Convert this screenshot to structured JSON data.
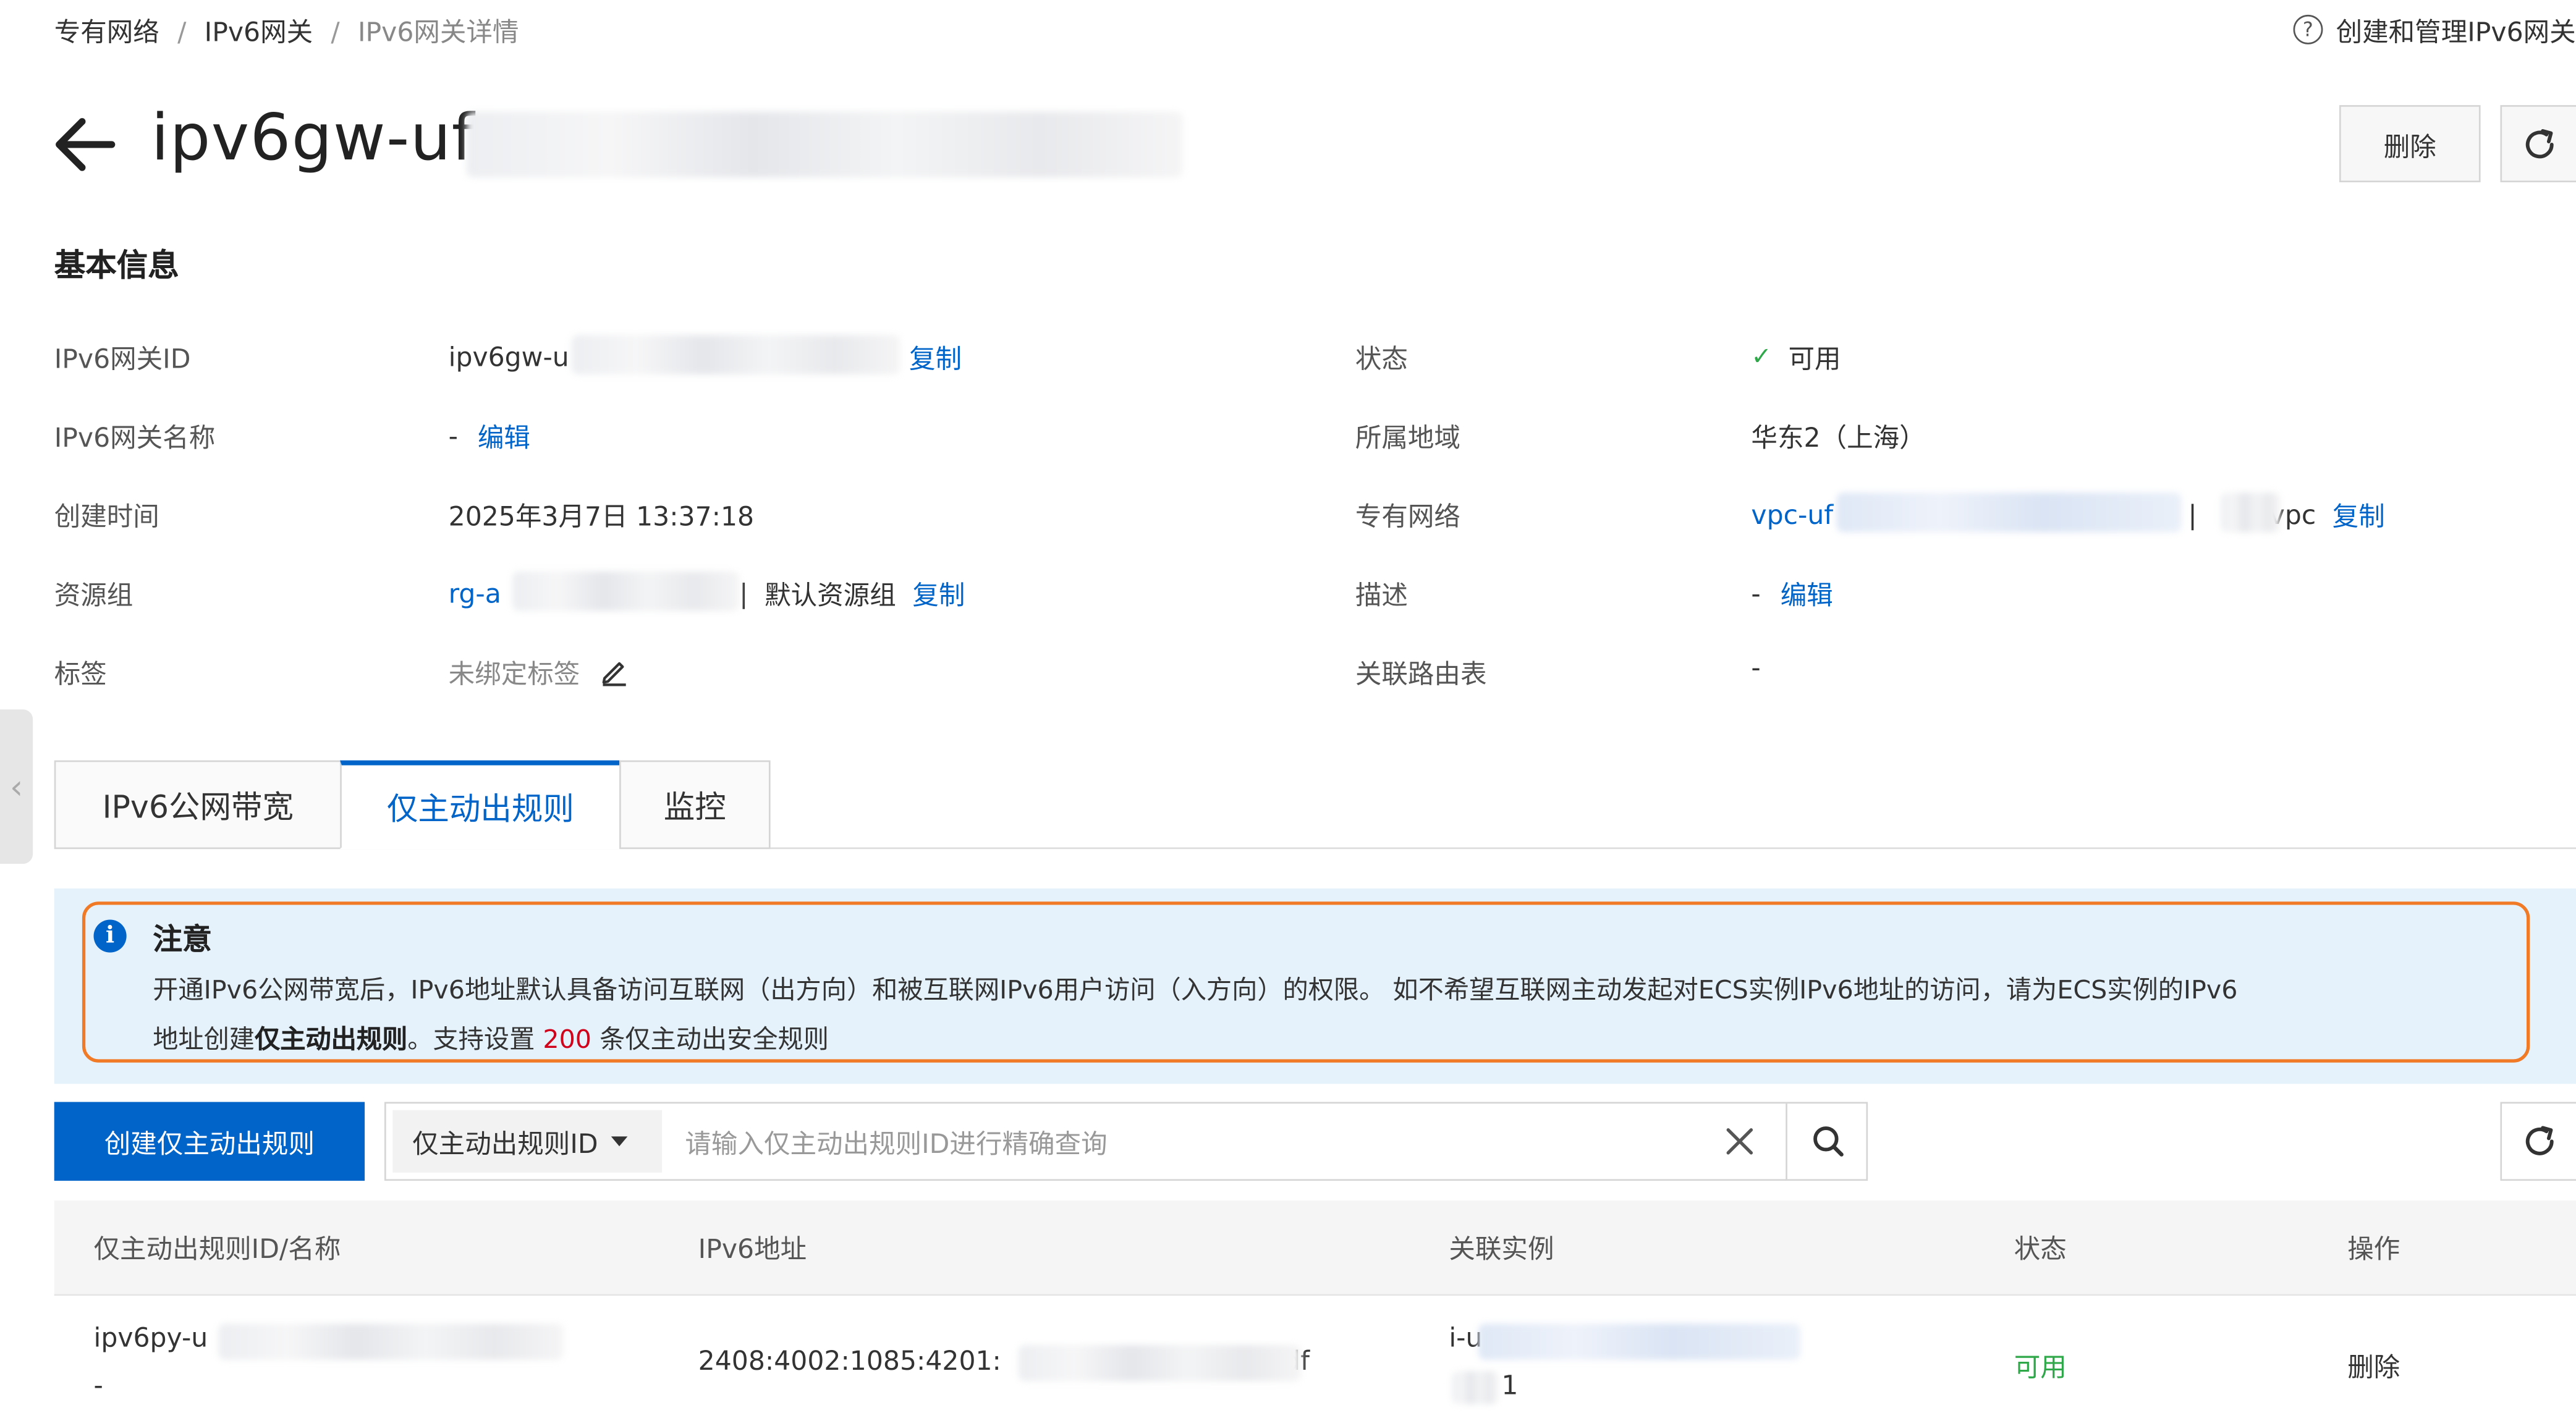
{
  "breadcrumb": {
    "items": [
      "专有网络",
      "IPv6网关",
      "IPv6网关详情"
    ],
    "separator": "/"
  },
  "help_link": {
    "icon": "question-circle-icon",
    "label": "创建和管理IPv6网关"
  },
  "header": {
    "back_icon": "arrow-left-icon",
    "title": "ipv6gw-uf",
    "delete_label": "删除",
    "refresh_icon": "refresh-icon"
  },
  "basic_info": {
    "title": "基本信息",
    "left": [
      {
        "label": "IPv6网关ID",
        "value": "ipv6gw-u",
        "action": "复制"
      },
      {
        "label": "IPv6网关名称",
        "value": "-",
        "action": "编辑"
      },
      {
        "label": "创建时间",
        "value": "2025年3月7日 13:37:18"
      },
      {
        "label": "资源组",
        "value": "rg-a",
        "name": "默认资源组",
        "action": "复制"
      },
      {
        "label": "标签",
        "value": "未绑定标签",
        "icon": "pencil-icon"
      }
    ],
    "right": [
      {
        "label": "状态",
        "value": "可用",
        "icon": "check-icon"
      },
      {
        "label": "所属地域",
        "value": "华东2（上海）"
      },
      {
        "label": "专有网络",
        "value": "vpc-uf",
        "name": "vpc",
        "action": "复制"
      },
      {
        "label": "描述",
        "value": "-",
        "action": "编辑"
      },
      {
        "label": "关联路由表",
        "value": "-"
      }
    ]
  },
  "tabs": [
    {
      "label": "IPv6公网带宽",
      "active": false
    },
    {
      "label": "仅主动出规则",
      "active": true
    },
    {
      "label": "监控",
      "active": false
    }
  ],
  "notice": {
    "icon": "info-circle-icon",
    "title": "注意",
    "line1": "开通IPv6公网带宽后，IPv6地址默认具备访问互联网（出方向）和被互联网IPv6用户访问（入方向）的权限。 如不希望互联网主动发起对ECS实例IPv6地址的访问，请为ECS实例的IPv6",
    "line2_prefix": "地址创建",
    "line2_bold": "仅主动出规则",
    "line2_mid": "。支持设置 ",
    "line2_count": "200",
    "line2_suffix": " 条仅主动出安全规则"
  },
  "toolbar": {
    "create_label": "创建仅主动出规则",
    "filter_select": "仅主动出规则ID",
    "search_placeholder": "请输入仅主动出规则ID进行精确查询",
    "clear_icon": "close-icon",
    "search_icon": "search-icon",
    "refresh_icon": "refresh-icon"
  },
  "table": {
    "columns": [
      "仅主动出规则ID/名称",
      "IPv6地址",
      "关联实例",
      "状态",
      "操作"
    ],
    "rows": [
      {
        "id": "ipv6py-u",
        "name": "-",
        "ipv6_prefix": "2408:4002:1085:4201:",
        "ipv6_suffix": "df",
        "instance_id": "i-u",
        "instance_sub": "1",
        "status": "可用",
        "action": "删除"
      }
    ]
  },
  "colors": {
    "primary": "#0064c8",
    "success": "#2fa84a",
    "highlight_border": "#f07a25",
    "notice_bg": "#e5f2fc",
    "count_red": "#d0021b"
  }
}
